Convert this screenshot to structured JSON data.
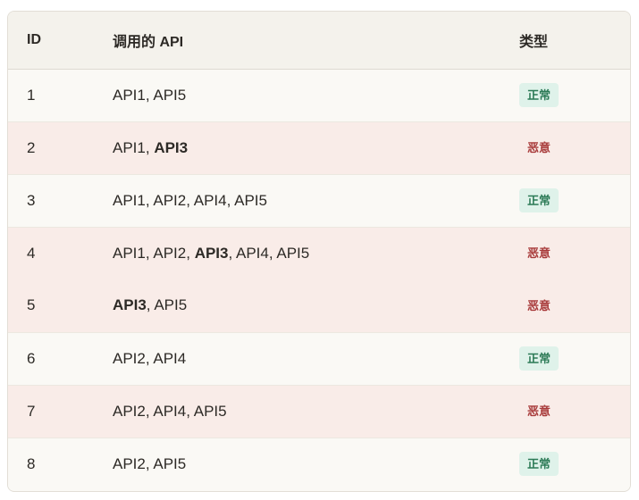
{
  "table": {
    "headers": {
      "id": "ID",
      "apis": "调用的 API",
      "type": "类型"
    },
    "rows": [
      {
        "id": "1",
        "apis": [
          {
            "text": "API1",
            "bold": false
          },
          {
            "text": "API5",
            "bold": false
          }
        ],
        "type": "正常",
        "status": "normal"
      },
      {
        "id": "2",
        "apis": [
          {
            "text": "API1",
            "bold": false
          },
          {
            "text": "API3",
            "bold": true
          }
        ],
        "type": "恶意",
        "status": "malicious"
      },
      {
        "id": "3",
        "apis": [
          {
            "text": "API1",
            "bold": false
          },
          {
            "text": "API2",
            "bold": false
          },
          {
            "text": "API4",
            "bold": false
          },
          {
            "text": "API5",
            "bold": false
          }
        ],
        "type": "正常",
        "status": "normal"
      },
      {
        "id": "4",
        "apis": [
          {
            "text": "API1",
            "bold": false
          },
          {
            "text": "API2",
            "bold": false
          },
          {
            "text": "API3",
            "bold": true
          },
          {
            "text": "API4",
            "bold": false
          },
          {
            "text": "API5",
            "bold": false
          }
        ],
        "type": "恶意",
        "status": "malicious"
      },
      {
        "id": "5",
        "apis": [
          {
            "text": "API3",
            "bold": true
          },
          {
            "text": "API5",
            "bold": false
          }
        ],
        "type": "恶意",
        "status": "malicious"
      },
      {
        "id": "6",
        "apis": [
          {
            "text": "API2",
            "bold": false
          },
          {
            "text": "API4",
            "bold": false
          }
        ],
        "type": "正常",
        "status": "normal"
      },
      {
        "id": "7",
        "apis": [
          {
            "text": "API2",
            "bold": false
          },
          {
            "text": "API4",
            "bold": false
          },
          {
            "text": "API5",
            "bold": false
          }
        ],
        "type": "恶意",
        "status": "malicious"
      },
      {
        "id": "8",
        "apis": [
          {
            "text": "API2",
            "bold": false
          },
          {
            "text": "API5",
            "bold": false
          }
        ],
        "type": "正常",
        "status": "normal"
      }
    ],
    "separator": ", "
  },
  "colors": {
    "normal_row_bg": "#faf9f5",
    "malicious_row_bg": "#f9ece8",
    "normal_badge_bg": "#dff2ea",
    "normal_badge_text": "#2c7a56",
    "malicious_text": "#a83a3a"
  }
}
